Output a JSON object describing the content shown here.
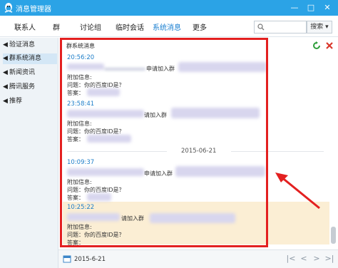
{
  "window": {
    "title": "消息管理器",
    "minimize": "—",
    "maximize": "□",
    "close": "✕"
  },
  "tabs": [
    {
      "label": "联系人"
    },
    {
      "label": "群"
    },
    {
      "label": "讨论组"
    },
    {
      "label": "临时会话"
    },
    {
      "label": "系统消息"
    },
    {
      "label": "更多"
    }
  ],
  "active_tab": "系统消息",
  "search": {
    "placeholder": "",
    "button": "搜索 ▾"
  },
  "sidebar": {
    "items": [
      {
        "label": "验证消息"
      },
      {
        "label": "群系统消息"
      },
      {
        "label": "新闻资讯"
      },
      {
        "label": "腾讯服务"
      },
      {
        "label": "推荐"
      }
    ],
    "active": "群系统消息"
  },
  "main": {
    "section_title": "群系统消息",
    "date_separator": "2015-06-21",
    "messages": [
      {
        "time": "20:56:20",
        "action": "申请加入群",
        "extra": "附加信息:",
        "question": "问题：你的百度ID是？",
        "answer": "答案："
      },
      {
        "time": "23:58:41",
        "action": "请加入群",
        "extra": "附加信息:",
        "question": "问题：你的百度ID是？",
        "answer": "答案："
      },
      {
        "time": "10:09:37",
        "action": "申请加入群",
        "extra": "附加信息:",
        "question": "问题：你的百度ID是？",
        "answer": "答案："
      },
      {
        "time": "10:25:22",
        "action": "请加入群",
        "extra": "附加信息:",
        "question": "问题：你的百度ID是？",
        "answer": "答案："
      }
    ]
  },
  "bottom": {
    "date": "2015-6-21",
    "first": "|<",
    "prev": "<",
    "next": ">",
    "last": ">|"
  },
  "colors": {
    "titlebar": "#2ba3e6",
    "accent": "#1a7fd0",
    "annotation": "#e32020",
    "highlight": "#fbeed4"
  }
}
